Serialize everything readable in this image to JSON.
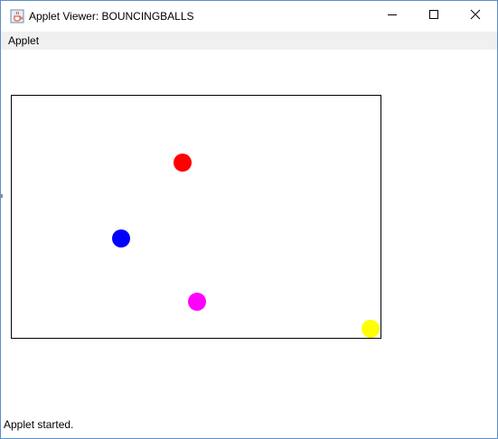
{
  "window": {
    "title": "Applet Viewer: BOUNCINGBALLS",
    "icon": "java-coffee-icon",
    "controls": {
      "minimize": "minimize-icon",
      "maximize": "maximize-icon",
      "close": "close-icon"
    }
  },
  "menubar": {
    "items": [
      {
        "label": "Applet"
      }
    ]
  },
  "status": {
    "text": "Applet started."
  },
  "canvas": {
    "background": "#ffffff",
    "border": "#000000",
    "balls": [
      {
        "color_name": "red",
        "color": "#ff0000"
      },
      {
        "color_name": "blue",
        "color": "#0000ff"
      },
      {
        "color_name": "magenta",
        "color": "#ff00ff"
      },
      {
        "color_name": "yellow",
        "color": "#ffff00"
      }
    ]
  }
}
